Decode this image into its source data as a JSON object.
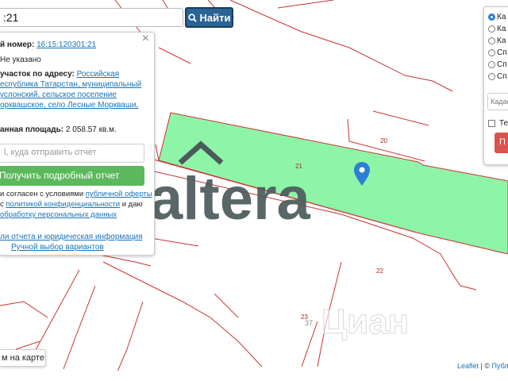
{
  "search": {
    "value": ":21",
    "button_label": "Найти"
  },
  "panel": {
    "cadastral_label": "й номер:",
    "cadastral_number": "16:15:120301:21",
    "status": "Не указано",
    "address_label": "участок по адресу:",
    "address_lines": [
      "Российская",
      "еспублика Татарстан, муниципальный",
      "услонский, сельское поселение",
      "орквашское, село Лесные Моркваши,"
    ],
    "area_label": "анная площадь:",
    "area_value": "2 058.57 кв.м.",
    "email_placeholder": "l, куда отправить отчет",
    "report_button": "Получить подробный отчет",
    "terms": {
      "line1_prefix": "и согласен с условиями ",
      "line1_link": "публичной оферты",
      "line2_prefix": "с ",
      "line2_link": "политикой конфиденциальности",
      "line2_suffix": " и даю",
      "line3_link": "обработку персональных данных"
    },
    "legal_link": "ли отчета и юридическая информация",
    "manual_link": "Ручной выбор вариантов"
  },
  "layers": {
    "options": [
      "Ка",
      "Ка",
      "Ка",
      "Сп",
      "Сп",
      "Сп"
    ],
    "selected_index": 0,
    "kadastr_placeholder": "Кадас",
    "checkbox_label": "Те",
    "button_label": "П"
  },
  "map": {
    "parcel_labels": [
      "21",
      "20",
      "22",
      "22",
      "23",
      "37"
    ],
    "watermark": "altera",
    "watermark_faint": "Циан"
  },
  "map_question": "м на карте?",
  "attribution": {
    "leaflet": "Leaflet",
    "separator": " | © ",
    "rest": "Публич"
  },
  "colors": {
    "parcel_fill": "#8ef5a8",
    "boundary": "#cc3333",
    "marker": "#2a7fd4",
    "watermark": "#4b5a5c"
  }
}
